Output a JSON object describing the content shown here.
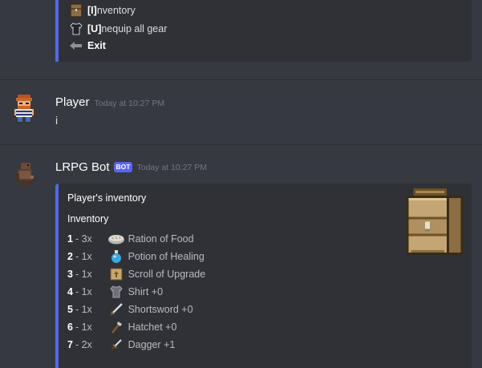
{
  "menu": [
    {
      "icon": "chest-icon",
      "key": "[I]",
      "rest": "nventory"
    },
    {
      "icon": "shirt-icon",
      "key": "[U]",
      "rest": "nequip all gear"
    },
    {
      "icon": "exit-arrow-icon",
      "key": "Exit",
      "rest": ""
    }
  ],
  "messages": [
    {
      "username": "Player",
      "timestamp": "Today at 10:27 PM",
      "text": "i"
    },
    {
      "username": "LRPG Bot",
      "badge": "BOT",
      "timestamp": "Today at 10:27 PM"
    }
  ],
  "embed": {
    "title": "Player's inventory",
    "field_name": "Inventory",
    "thumbnail": "backpack-icon",
    "items": [
      {
        "num": "1",
        "qty": "3x",
        "icon": "bread-icon",
        "name": "Ration of Food"
      },
      {
        "num": "2",
        "qty": "1x",
        "icon": "potion-icon",
        "name": "Potion of Healing"
      },
      {
        "num": "3",
        "qty": "1x",
        "icon": "scroll-icon",
        "name": "Scroll of Upgrade"
      },
      {
        "num": "4",
        "qty": "1x",
        "icon": "shirt-icon",
        "name": "Shirt +0"
      },
      {
        "num": "5",
        "qty": "1x",
        "icon": "shortsword-icon",
        "name": "Shortsword +0"
      },
      {
        "num": "6",
        "qty": "1x",
        "icon": "hatchet-icon",
        "name": "Hatchet +0"
      },
      {
        "num": "7",
        "qty": "2x",
        "icon": "dagger-icon",
        "name": "Dagger +1"
      }
    ]
  },
  "colors": {
    "accent": "#5865f2",
    "background": "#36393f",
    "embed_bg": "#2f3136"
  }
}
